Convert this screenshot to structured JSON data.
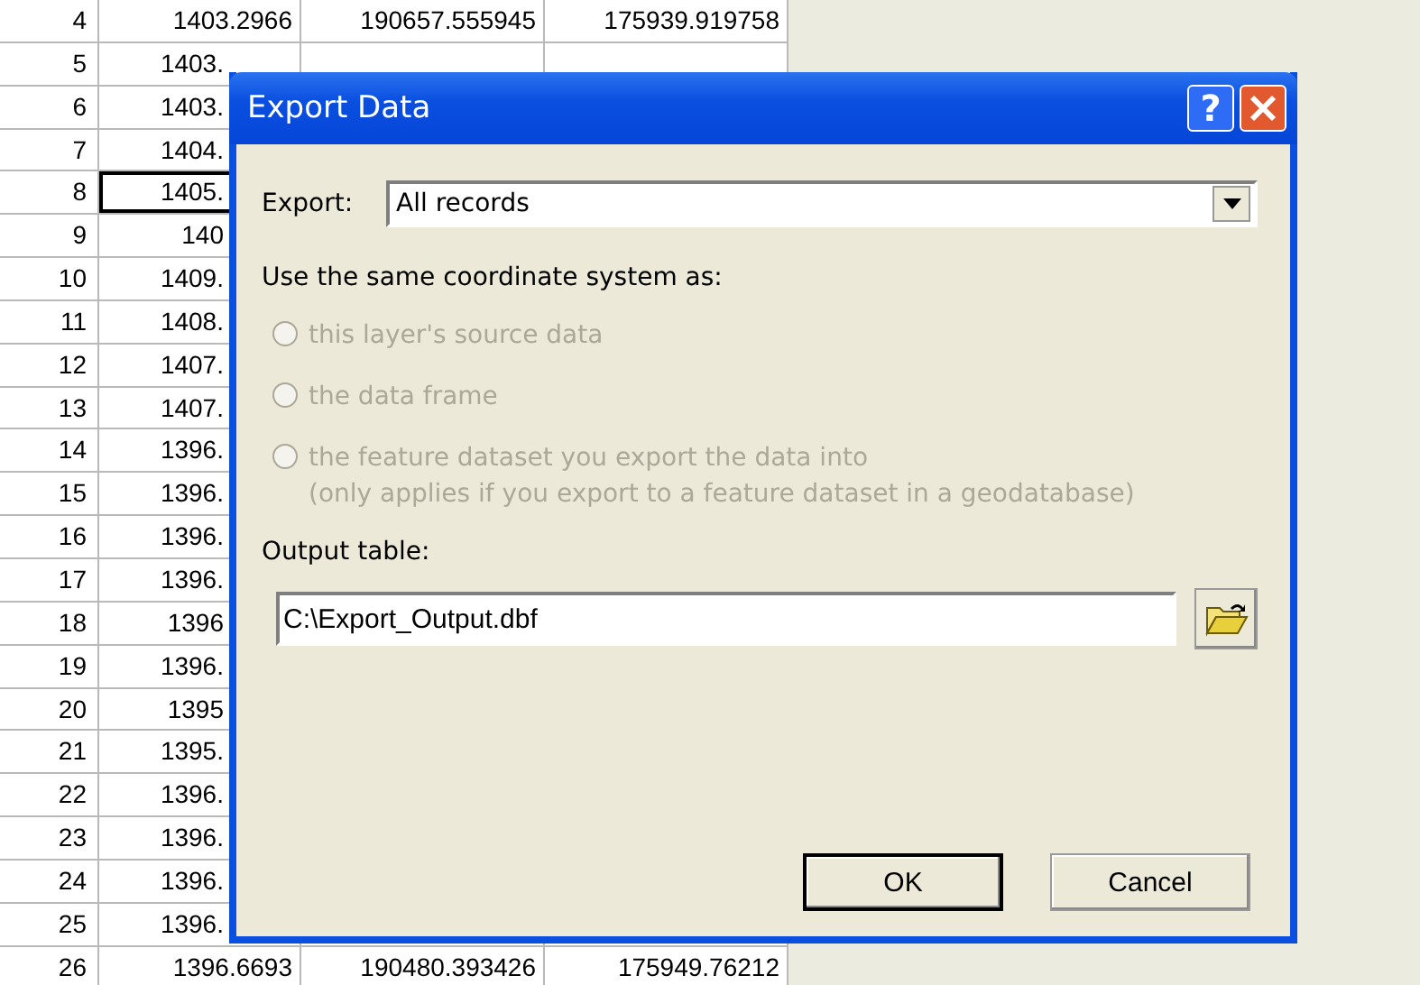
{
  "table": {
    "rows": [
      {
        "id": "4",
        "cells": [
          "1403.2966",
          "190657.555945",
          "175939.919758"
        ],
        "selected": false
      },
      {
        "id": "5",
        "cells": [
          "1403."
        ],
        "selected": false
      },
      {
        "id": "6",
        "cells": [
          "1403."
        ],
        "selected": false
      },
      {
        "id": "7",
        "cells": [
          "1404."
        ],
        "selected": false
      },
      {
        "id": "8",
        "cells": [
          "1405."
        ],
        "selected": true
      },
      {
        "id": "9",
        "cells": [
          "140"
        ],
        "selected": false
      },
      {
        "id": "10",
        "cells": [
          "1409."
        ],
        "selected": false
      },
      {
        "id": "11",
        "cells": [
          "1408."
        ],
        "selected": false
      },
      {
        "id": "12",
        "cells": [
          "1407."
        ],
        "selected": false
      },
      {
        "id": "13",
        "cells": [
          "1407."
        ],
        "selected": false
      },
      {
        "id": "14",
        "cells": [
          "1396."
        ],
        "selected": false
      },
      {
        "id": "15",
        "cells": [
          "1396."
        ],
        "selected": false
      },
      {
        "id": "16",
        "cells": [
          "1396."
        ],
        "selected": false
      },
      {
        "id": "17",
        "cells": [
          "1396."
        ],
        "selected": false
      },
      {
        "id": "18",
        "cells": [
          "1396"
        ],
        "selected": false
      },
      {
        "id": "19",
        "cells": [
          "1396."
        ],
        "selected": false
      },
      {
        "id": "20",
        "cells": [
          "1395"
        ],
        "selected": false
      },
      {
        "id": "21",
        "cells": [
          "1395."
        ],
        "selected": false
      },
      {
        "id": "22",
        "cells": [
          "1396."
        ],
        "selected": false
      },
      {
        "id": "23",
        "cells": [
          "1396."
        ],
        "selected": false
      },
      {
        "id": "24",
        "cells": [
          "1396."
        ],
        "selected": false
      },
      {
        "id": "25",
        "cells": [
          "1396."
        ],
        "selected": false
      },
      {
        "id": "26",
        "cells": [
          "1396.6693",
          "190480.393426",
          "175949.76212"
        ],
        "selected": false
      }
    ]
  },
  "dialog": {
    "title": "Export Data",
    "help": "?",
    "export_label": "Export:",
    "export_value": "All records",
    "coord_label": "Use the same coordinate system as:",
    "options": [
      {
        "label": "this layer's source data",
        "selected": false,
        "disabled": true
      },
      {
        "label": "the data frame",
        "selected": false,
        "disabled": true
      },
      {
        "label": "the feature dataset you export the data into",
        "note": "(only applies if you export to a feature dataset in a geodatabase)",
        "selected": false,
        "disabled": true
      }
    ],
    "output_label": "Output table:",
    "output_value": "C:\\Export_Output.dbf",
    "buttons": [
      {
        "label": "OK",
        "default": true
      },
      {
        "label": "Cancel",
        "default": false
      }
    ]
  }
}
